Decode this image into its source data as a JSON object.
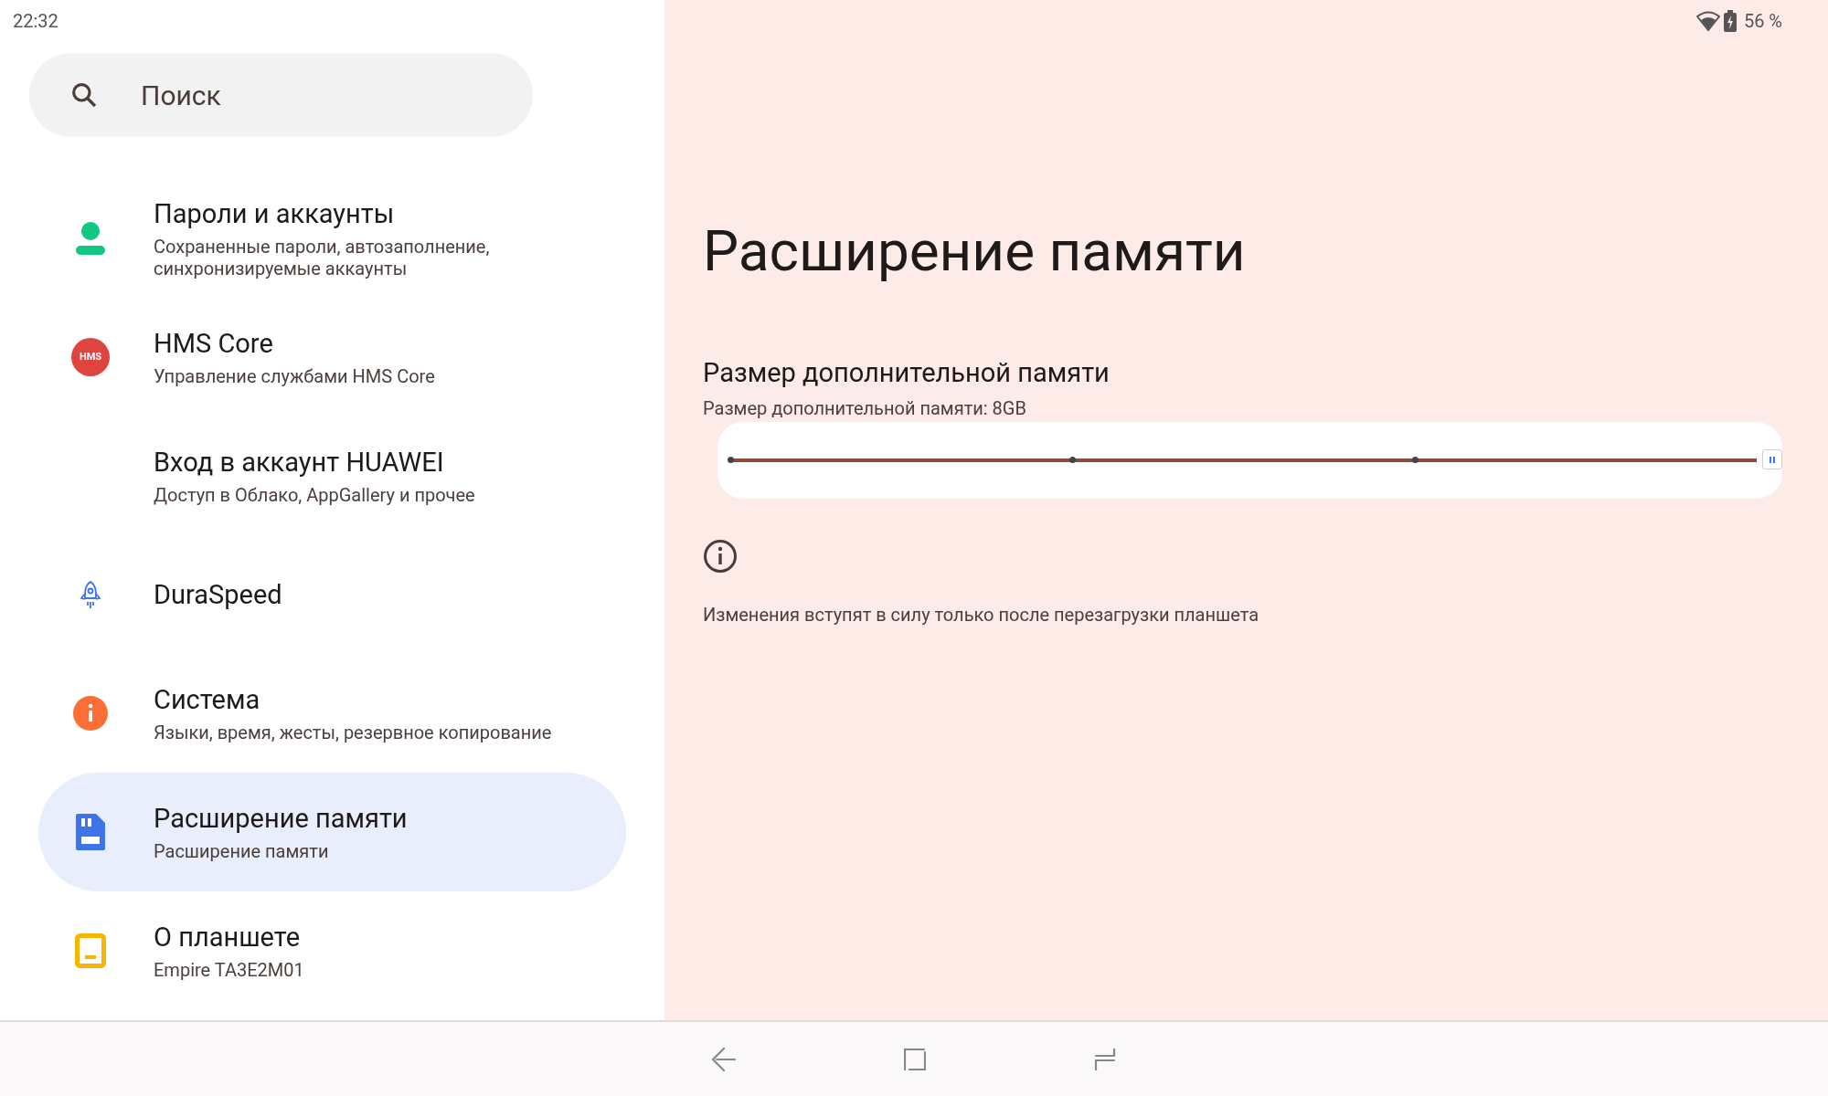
{
  "status_bar": {
    "time": "22:32",
    "battery": "56 %"
  },
  "search": {
    "placeholder": "Поиск"
  },
  "sidebar": {
    "items": [
      {
        "kind": "person",
        "title": "Пароли и аккаунты",
        "subtitle": "Сохраненные пароли, автозаполнение, синхронизируемые аккаунты",
        "selected": false
      },
      {
        "kind": "hms",
        "badge": "HMS",
        "title": "HMS Core",
        "subtitle": "Управление службами HMS Core",
        "selected": false
      },
      {
        "kind": "plain",
        "title": "Вход в аккаунт HUAWEI",
        "subtitle": "Доступ в Облако, AppGallery и прочее",
        "selected": false
      },
      {
        "kind": "rocket",
        "title": "DuraSpeed",
        "selected": false
      },
      {
        "kind": "info",
        "title": "Система",
        "subtitle": "Языки, время, жесты, резервное копирование",
        "selected": false
      },
      {
        "kind": "card",
        "title": "Расширение памяти",
        "subtitle": "Расширение памяти",
        "selected": true
      },
      {
        "kind": "tablet",
        "title": "О планшете",
        "subtitle": "Empire TA3E2M01",
        "selected": false
      }
    ]
  },
  "page": {
    "title": "Расширение памяти",
    "setting": {
      "title": "Размер дополнительной памяти",
      "summary": "Размер дополнительной памяти: 8GB",
      "slider": {
        "level": 1
      }
    },
    "note": "Изменения вступят в силу только после перезагрузки планшета"
  }
}
